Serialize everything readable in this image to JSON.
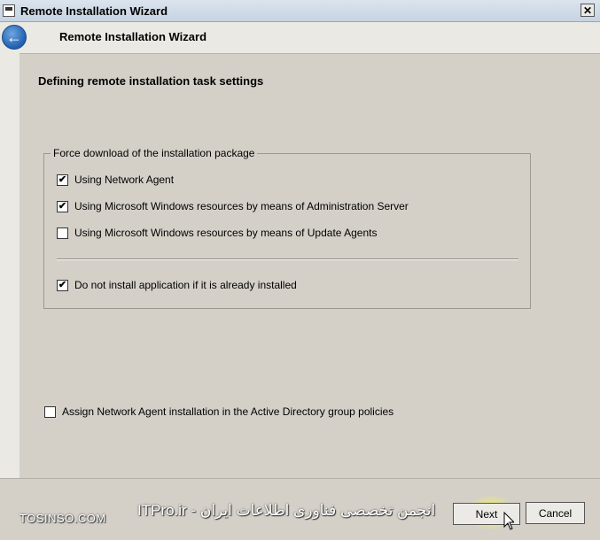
{
  "window": {
    "title": "Remote Installation Wizard",
    "close_label": "✕"
  },
  "header": {
    "title": "Remote Installation Wizard",
    "back_label": "←"
  },
  "section": {
    "title": "Defining remote installation task settings"
  },
  "group": {
    "legend": "Force download of the installation package",
    "options": [
      {
        "label": "Using Network Agent",
        "checked": true
      },
      {
        "label": "Using Microsoft Windows resources by means of Administration Server",
        "checked": true
      },
      {
        "label": "Using Microsoft Windows resources by means of Update Agents",
        "checked": false
      }
    ],
    "skip_installed": {
      "label": "Do not install application if it is already installed",
      "checked": true
    }
  },
  "assign_policy": {
    "label": "Assign Network Agent installation in the Active Directory group policies",
    "checked": false
  },
  "footer": {
    "next_label": "Next",
    "cancel_label": "Cancel",
    "watermark_site": "TOSINSO.COM",
    "watermark_fa": "ITPro.ir - انجمن تخصصی فناوری اطلاعات ایران"
  },
  "colors": {
    "background": "#d4d0c8",
    "header_bg": "#ebe9e4",
    "accent": "#1f5fb0"
  }
}
